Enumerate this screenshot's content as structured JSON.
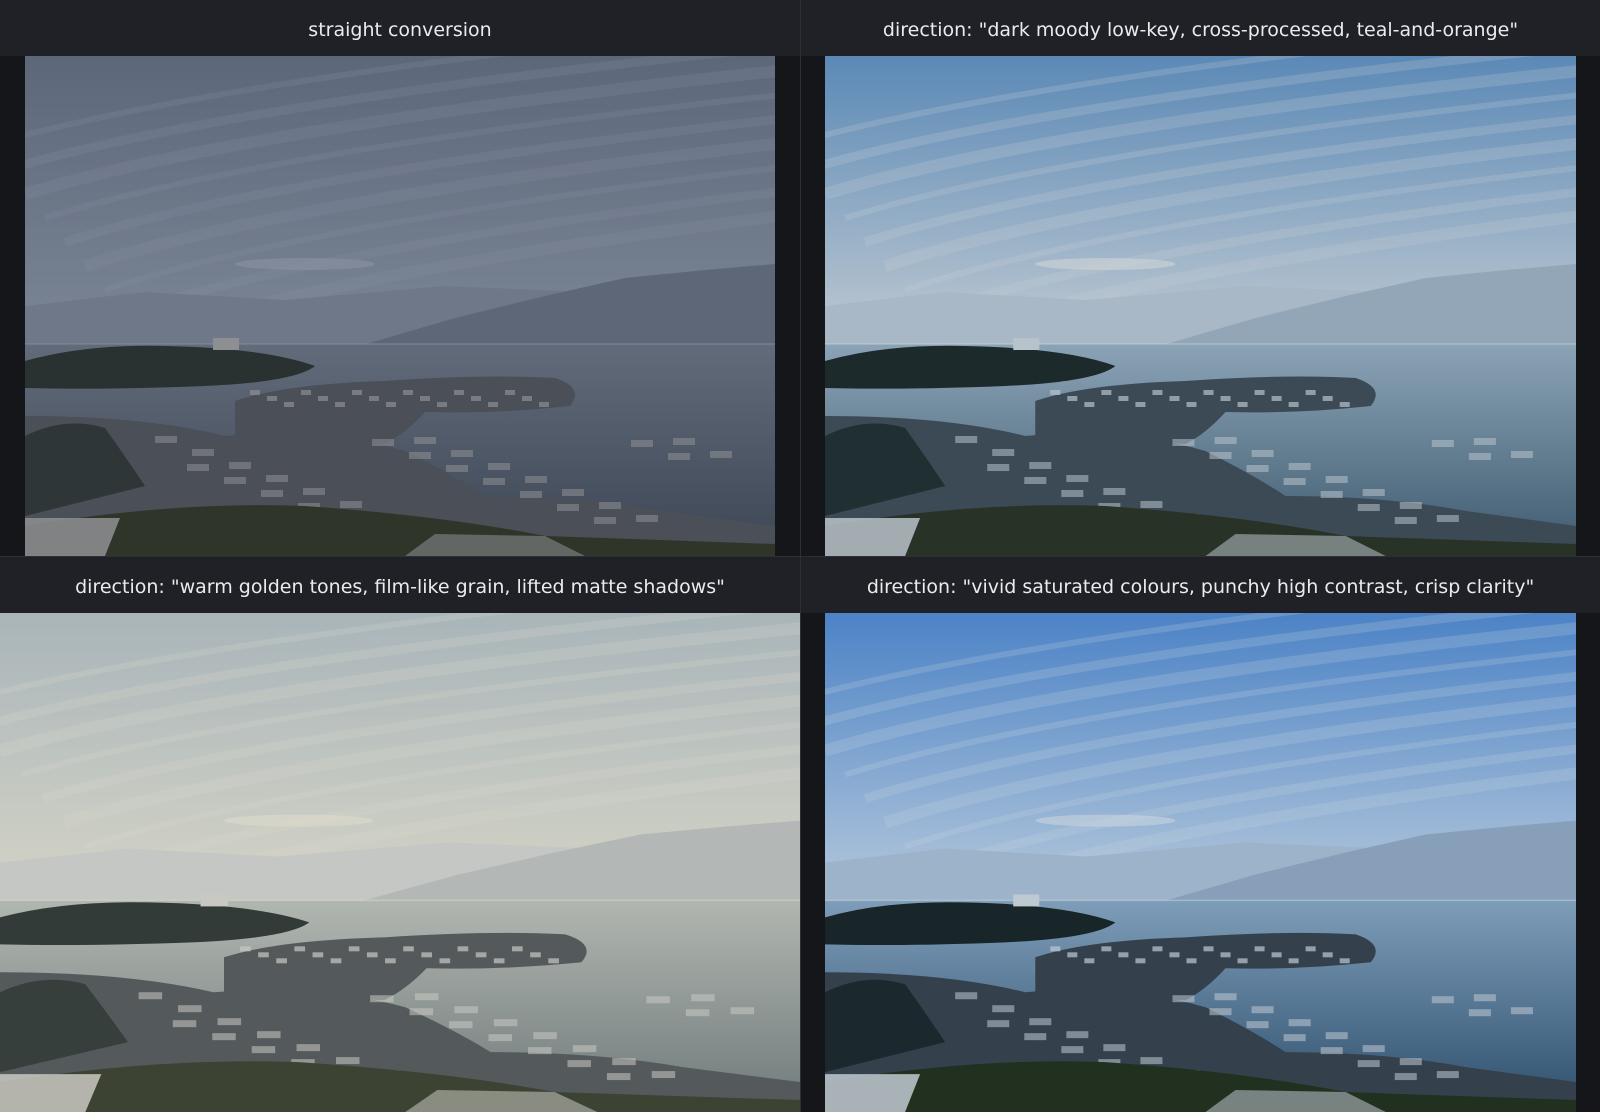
{
  "panels": [
    {
      "caption": "straight conversion",
      "palette": {
        "sky_top": "#5c677a",
        "sky_bottom": "#7d8797",
        "haze": "#8a93a3",
        "mountain_far": "#6f7889",
        "mountain_near": "#5e6778",
        "water_top": "#616b7a",
        "water_bottom": "#3d4654",
        "land": "#2a3131",
        "town": "#4a4f58",
        "roof": "#8e8f93",
        "fg": "#2f3529"
      }
    },
    {
      "caption": "direction: \"dark moody low-key, cross-processed, teal-and-orange\"",
      "palette": {
        "sky_top": "#5b89b6",
        "sky_bottom": "#c3ccd3",
        "haze": "#cfd3d5",
        "mountain_far": "#a9b8c6",
        "mountain_near": "#93a6b8",
        "water_top": "#8ba3b6",
        "water_bottom": "#3e5a6e",
        "land": "#1c2a2c",
        "town": "#3b4a55",
        "roof": "#b8c2ca",
        "fg": "#283227"
      }
    },
    {
      "caption": "direction: \"warm golden tones, film-like grain, lifted matte shadows\"",
      "palette": {
        "sky_top": "#a9b5ba",
        "sky_bottom": "#d6d5c6",
        "haze": "#dcdacb",
        "mountain_far": "#c4c7c3",
        "mountain_near": "#b3b8b6",
        "water_top": "#b1b6b0",
        "water_bottom": "#6f7a7b",
        "land": "#323b37",
        "town": "#545a5c",
        "roof": "#c9c8c2",
        "fg": "#3d4332"
      }
    },
    {
      "caption": "direction: \"vivid saturated colours, punchy high contrast, crisp clarity\"",
      "palette": {
        "sky_top": "#4c83c6",
        "sky_bottom": "#b9cbdc",
        "haze": "#c8d4de",
        "mountain_far": "#9db3c9",
        "mountain_near": "#879fb8",
        "water_top": "#7d9db9",
        "water_bottom": "#2e4f6c",
        "land": "#18262a",
        "town": "#34414d",
        "roof": "#bfc9d2",
        "fg": "#22301f"
      }
    }
  ]
}
